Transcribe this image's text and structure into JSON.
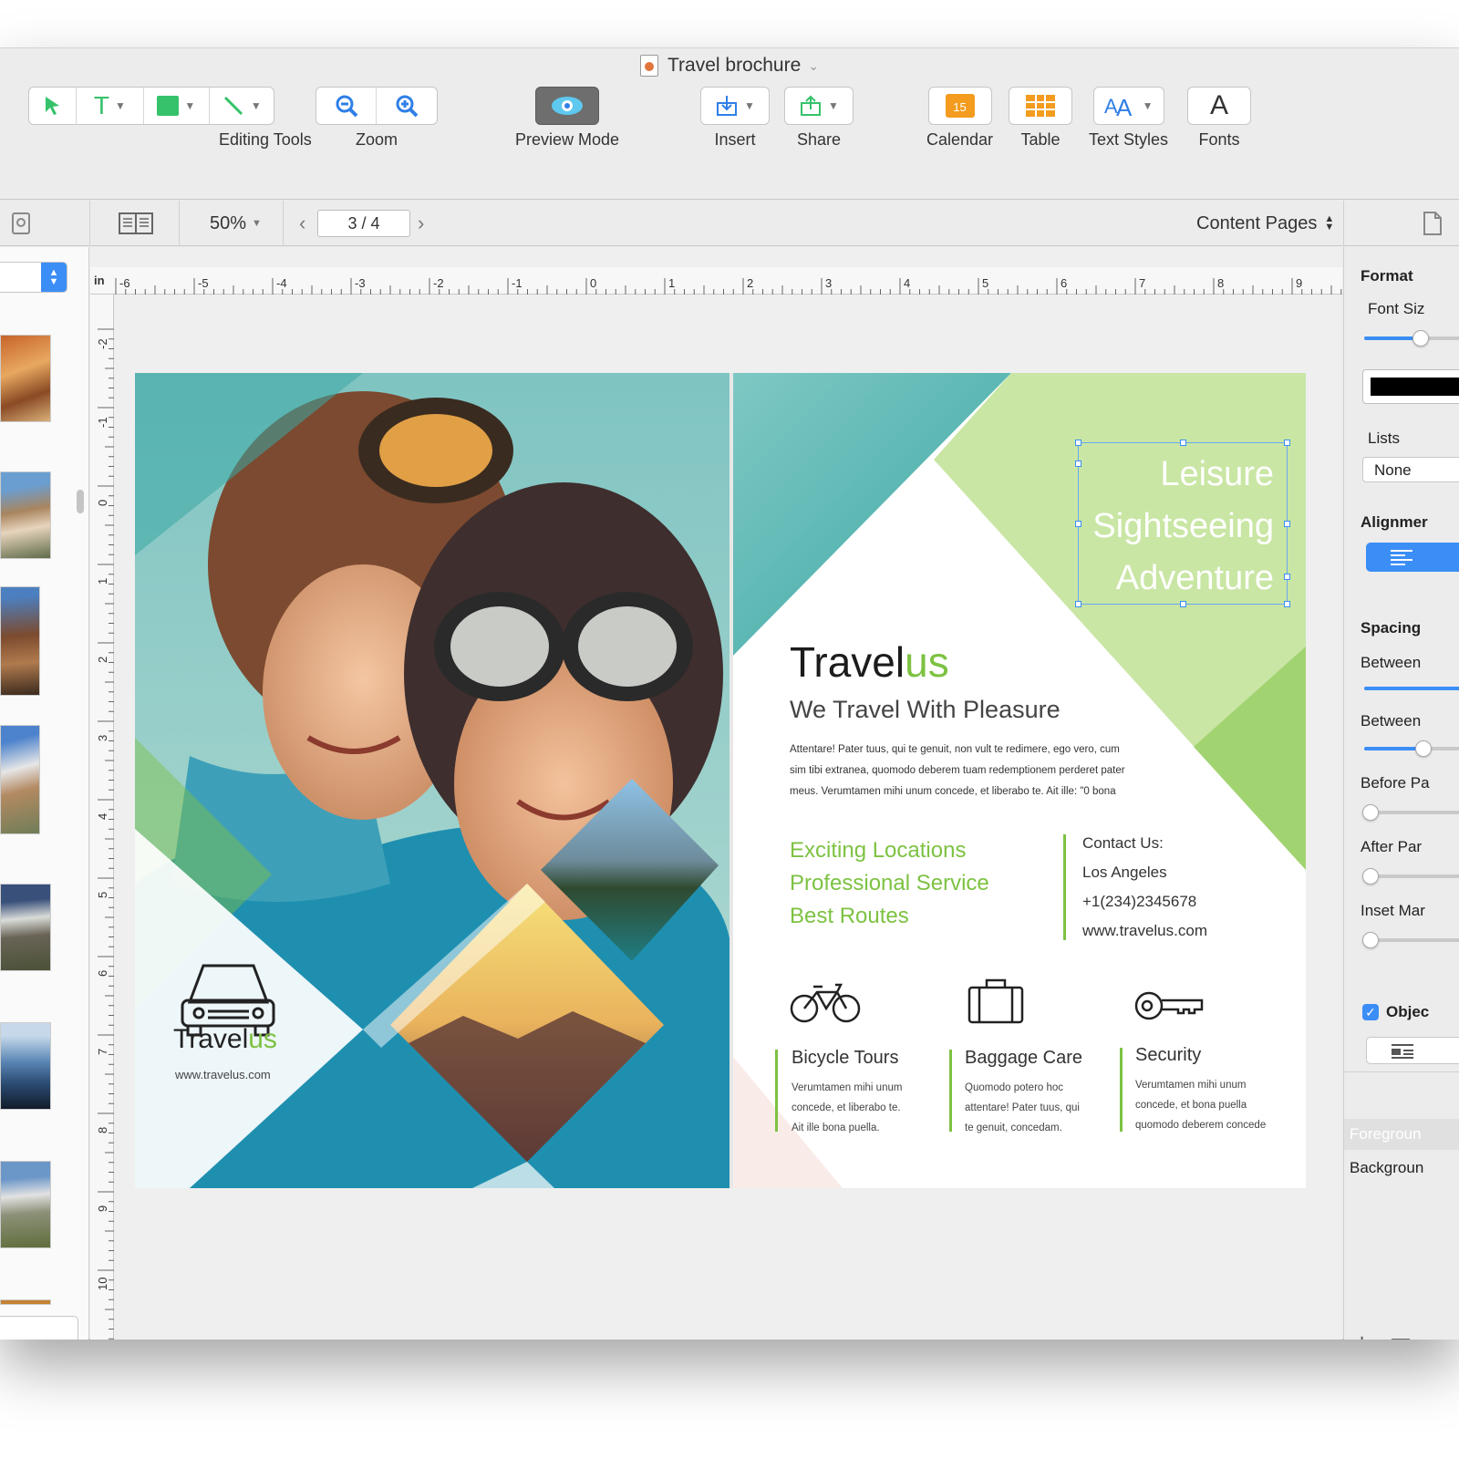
{
  "window": {
    "title": "Travel brochure"
  },
  "toolbar": {
    "editing_tools_label": "Editing Tools",
    "zoom_label": "Zoom",
    "preview_mode_label": "Preview Mode",
    "insert_label": "Insert",
    "share_label": "Share",
    "calendar_label": "Calendar",
    "calendar_day": "15",
    "table_label": "Table",
    "text_styles_label": "Text Styles",
    "fonts_label": "Fonts",
    "fonts_glyph": "A",
    "text_tool_glyph": "T"
  },
  "subbar": {
    "zoom_value": "50%",
    "page_indicator": "3 / 4",
    "content_selector": "Content Pages"
  },
  "ruler": {
    "unit": "in",
    "h_labels": [
      "-6",
      "-5",
      "-4",
      "-3",
      "-2",
      "-1",
      "0",
      "1",
      "2",
      "3",
      "4",
      "5",
      "6",
      "7",
      "8",
      "9"
    ],
    "v_labels": [
      "-2",
      "-1",
      "0",
      "1",
      "2",
      "3",
      "4",
      "5",
      "6",
      "7",
      "8",
      "9",
      "10"
    ]
  },
  "brochure": {
    "left_brand_prefix": "Travel",
    "left_brand_suffix": "us",
    "left_url": "www.travelus.com",
    "tagline_lines": [
      "Leisure",
      "Sightseeing",
      "Adventure"
    ],
    "brand_prefix": "Travel",
    "brand_suffix": "us",
    "subtitle": "We Travel With Pleasure",
    "body_lines": [
      "Attentare! Pater tuus, qui te genuit, non vult te redimere, ego vero, cum",
      "sim tibi extranea, quomodo deberem tuam redemptionem perderet pater",
      "meus. Verumtamen mihi unum concede, et liberabo te. Ait ille: \"0 bona"
    ],
    "features": [
      "Exciting Locations",
      "Professional Service",
      "Best Routes"
    ],
    "contact": [
      "Contact Us:",
      "Los Angeles",
      "+1(234)2345678",
      "www.travelus.com"
    ],
    "services": [
      {
        "title": "Bicycle Tours",
        "lines": [
          "Verumtamen mihi unum",
          "concede, et liberabo te.",
          "Ait ille bona puella."
        ]
      },
      {
        "title": "Baggage Care",
        "lines": [
          "Quomodo potero hoc",
          "attentare! Pater tuus, qui",
          "te genuit, concedam."
        ]
      },
      {
        "title": "Security",
        "lines": [
          "Verumtamen mihi unum",
          "concede, et bona puella",
          "quomodo deberem concede"
        ]
      }
    ]
  },
  "inspector": {
    "format_heading": "Format",
    "font_size_label": "Font Siz",
    "lists_label": "Lists",
    "lists_value": "None",
    "alignment_label": "Alignmer",
    "spacing_heading": "Spacing",
    "between_1_label": "Between",
    "between_2_label": "Between",
    "before_label": "Before Pa",
    "after_label": "After Par",
    "inset_label": "Inset Mar",
    "object_checkbox_label": "Objec",
    "foreground_label": "Foregroun",
    "background_label": "Backgroun",
    "add_symbol": "+",
    "remove_symbol": "—"
  },
  "colors": {
    "accent_green": "#7dc242",
    "light_green": "#c9e6a4",
    "teal": "#3aa7a4",
    "system_blue": "#3b8ef6",
    "calendar_orange": "#f39c1f"
  }
}
